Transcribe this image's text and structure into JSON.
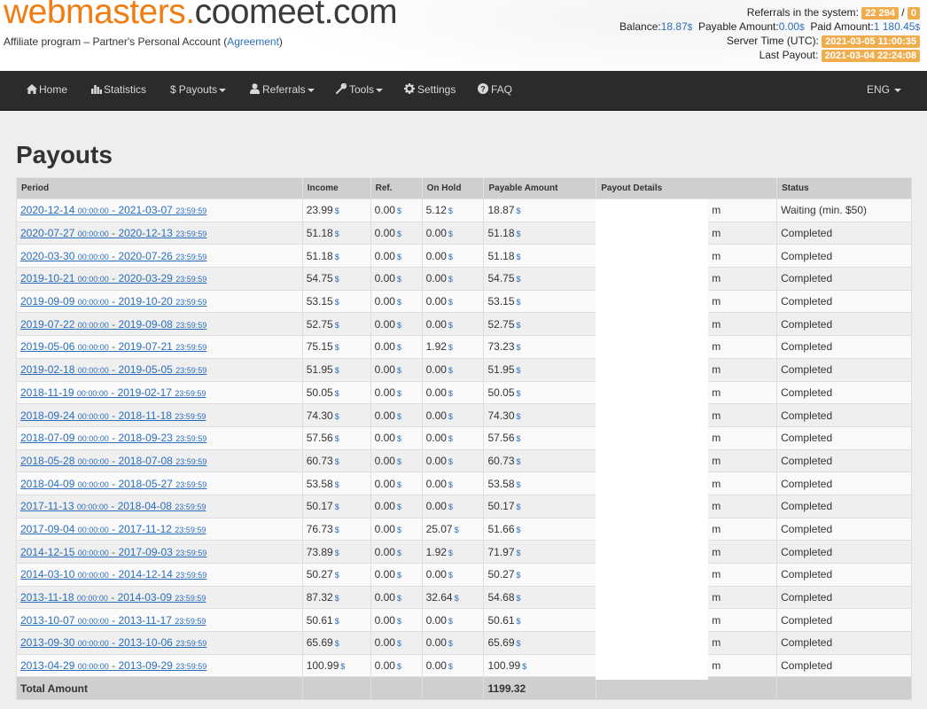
{
  "header": {
    "logo_part1": "webmasters.",
    "logo_part2": "coomeet.com",
    "subtitle_prefix": "Affiliate program – Partner's Personal Account (",
    "subtitle_link": "Agreement",
    "subtitle_suffix": ")"
  },
  "stats": {
    "referrals_label": "Referrals in the system:",
    "referrals_count": "22 294",
    "referrals_sep": "/",
    "referrals_new": "0",
    "balance_label": "Balance:",
    "balance_value": "18.87",
    "payable_label": "Payable Amount:",
    "payable_value": "0.00",
    "paid_label": "Paid Amount:",
    "paid_value": "1 180.45",
    "currency": "$",
    "server_time_label": "Server Time (UTC):",
    "server_time_value": "2021-03-05 11:00:35",
    "last_payout_label": "Last Payout:",
    "last_payout_value": "2021-03-04 22:24:08"
  },
  "nav": {
    "home": "Home",
    "statistics": "Statistics",
    "payouts": "Payouts",
    "referrals": "Referrals",
    "tools": "Tools",
    "settings": "Settings",
    "faq": "FAQ",
    "language": "ENG"
  },
  "page_title": "Payouts",
  "table": {
    "columns": [
      "Period",
      "Income",
      "Ref.",
      "On Hold",
      "Payable Amount",
      "Payout Details",
      "Status"
    ],
    "currency": "$",
    "rows": [
      {
        "start_date": "2020-12-14",
        "start_time": "00:00:00",
        "end_date": "2021-03-07",
        "end_time": "23:59:59",
        "income": "23.99",
        "ref": "0.00",
        "hold": "5.12",
        "payable": "18.87",
        "details": "m",
        "status": "Waiting (min. $50)"
      },
      {
        "start_date": "2020-07-27",
        "start_time": "00:00:00",
        "end_date": "2020-12-13",
        "end_time": "23:59:59",
        "income": "51.18",
        "ref": "0.00",
        "hold": "0.00",
        "payable": "51.18",
        "details": "m",
        "status": "Completed"
      },
      {
        "start_date": "2020-03-30",
        "start_time": "00:00:00",
        "end_date": "2020-07-26",
        "end_time": "23:59:59",
        "income": "51.18",
        "ref": "0.00",
        "hold": "0.00",
        "payable": "51.18",
        "details": "m",
        "status": "Completed"
      },
      {
        "start_date": "2019-10-21",
        "start_time": "00:00:00",
        "end_date": "2020-03-29",
        "end_time": "23:59:59",
        "income": "54.75",
        "ref": "0.00",
        "hold": "0.00",
        "payable": "54.75",
        "details": "m",
        "status": "Completed"
      },
      {
        "start_date": "2019-09-09",
        "start_time": "00:00:00",
        "end_date": "2019-10-20",
        "end_time": "23:59:59",
        "income": "53.15",
        "ref": "0.00",
        "hold": "0.00",
        "payable": "53.15",
        "details": "m",
        "status": "Completed"
      },
      {
        "start_date": "2019-07-22",
        "start_time": "00:00:00",
        "end_date": "2019-09-08",
        "end_time": "23:59:59",
        "income": "52.75",
        "ref": "0.00",
        "hold": "0.00",
        "payable": "52.75",
        "details": "m",
        "status": "Completed"
      },
      {
        "start_date": "2019-05-06",
        "start_time": "00:00:00",
        "end_date": "2019-07-21",
        "end_time": "23:59:59",
        "income": "75.15",
        "ref": "0.00",
        "hold": "1.92",
        "payable": "73.23",
        "details": "m",
        "status": "Completed"
      },
      {
        "start_date": "2019-02-18",
        "start_time": "00:00:00",
        "end_date": "2019-05-05",
        "end_time": "23:59:59",
        "income": "51.95",
        "ref": "0.00",
        "hold": "0.00",
        "payable": "51.95",
        "details": "m",
        "status": "Completed"
      },
      {
        "start_date": "2018-11-19",
        "start_time": "00:00:00",
        "end_date": "2019-02-17",
        "end_time": "23:59:59",
        "income": "50.05",
        "ref": "0.00",
        "hold": "0.00",
        "payable": "50.05",
        "details": "m",
        "status": "Completed"
      },
      {
        "start_date": "2018-09-24",
        "start_time": "00:00:00",
        "end_date": "2018-11-18",
        "end_time": "23:59:59",
        "income": "74.30",
        "ref": "0.00",
        "hold": "0.00",
        "payable": "74.30",
        "details": "m",
        "status": "Completed"
      },
      {
        "start_date": "2018-07-09",
        "start_time": "00:00:00",
        "end_date": "2018-09-23",
        "end_time": "23:59:59",
        "income": "57.56",
        "ref": "0.00",
        "hold": "0.00",
        "payable": "57.56",
        "details": "m",
        "status": "Completed"
      },
      {
        "start_date": "2018-05-28",
        "start_time": "00:00:00",
        "end_date": "2018-07-08",
        "end_time": "23:59:59",
        "income": "60.73",
        "ref": "0.00",
        "hold": "0.00",
        "payable": "60.73",
        "details": "m",
        "status": "Completed"
      },
      {
        "start_date": "2018-04-09",
        "start_time": "00:00:00",
        "end_date": "2018-05-27",
        "end_time": "23:59:59",
        "income": "53.58",
        "ref": "0.00",
        "hold": "0.00",
        "payable": "53.58",
        "details": "m",
        "status": "Completed"
      },
      {
        "start_date": "2017-11-13",
        "start_time": "00:00:00",
        "end_date": "2018-04-08",
        "end_time": "23:59:59",
        "income": "50.17",
        "ref": "0.00",
        "hold": "0.00",
        "payable": "50.17",
        "details": "m",
        "status": "Completed"
      },
      {
        "start_date": "2017-09-04",
        "start_time": "00:00:00",
        "end_date": "2017-11-12",
        "end_time": "23:59:59",
        "income": "76.73",
        "ref": "0.00",
        "hold": "25.07",
        "payable": "51.66",
        "details": "m",
        "status": "Completed"
      },
      {
        "start_date": "2014-12-15",
        "start_time": "00:00:00",
        "end_date": "2017-09-03",
        "end_time": "23:59:59",
        "income": "73.89",
        "ref": "0.00",
        "hold": "1.92",
        "payable": "71.97",
        "details": "m",
        "status": "Completed"
      },
      {
        "start_date": "2014-03-10",
        "start_time": "00:00:00",
        "end_date": "2014-12-14",
        "end_time": "23:59:59",
        "income": "50.27",
        "ref": "0.00",
        "hold": "0.00",
        "payable": "50.27",
        "details": "m",
        "status": "Completed"
      },
      {
        "start_date": "2013-11-18",
        "start_time": "00:00:00",
        "end_date": "2014-03-09",
        "end_time": "23:59:59",
        "income": "87.32",
        "ref": "0.00",
        "hold": "32.64",
        "payable": "54.68",
        "details": "m",
        "status": "Completed"
      },
      {
        "start_date": "2013-10-07",
        "start_time": "00:00:00",
        "end_date": "2013-11-17",
        "end_time": "23:59:59",
        "income": "50.61",
        "ref": "0.00",
        "hold": "0.00",
        "payable": "50.61",
        "details": "m",
        "status": "Completed"
      },
      {
        "start_date": "2013-09-30",
        "start_time": "00:00:00",
        "end_date": "2013-10-06",
        "end_time": "23:59:59",
        "income": "65.69",
        "ref": "0.00",
        "hold": "0.00",
        "payable": "65.69",
        "details": "m",
        "status": "Completed"
      },
      {
        "start_date": "2013-04-29",
        "start_time": "00:00:00",
        "end_date": "2013-09-29",
        "end_time": "23:59:59",
        "income": "100.99",
        "ref": "0.00",
        "hold": "0.00",
        "payable": "100.99",
        "details": "m",
        "status": "Completed"
      }
    ],
    "total_label": "Total Amount",
    "total_payable": "1199.32"
  }
}
